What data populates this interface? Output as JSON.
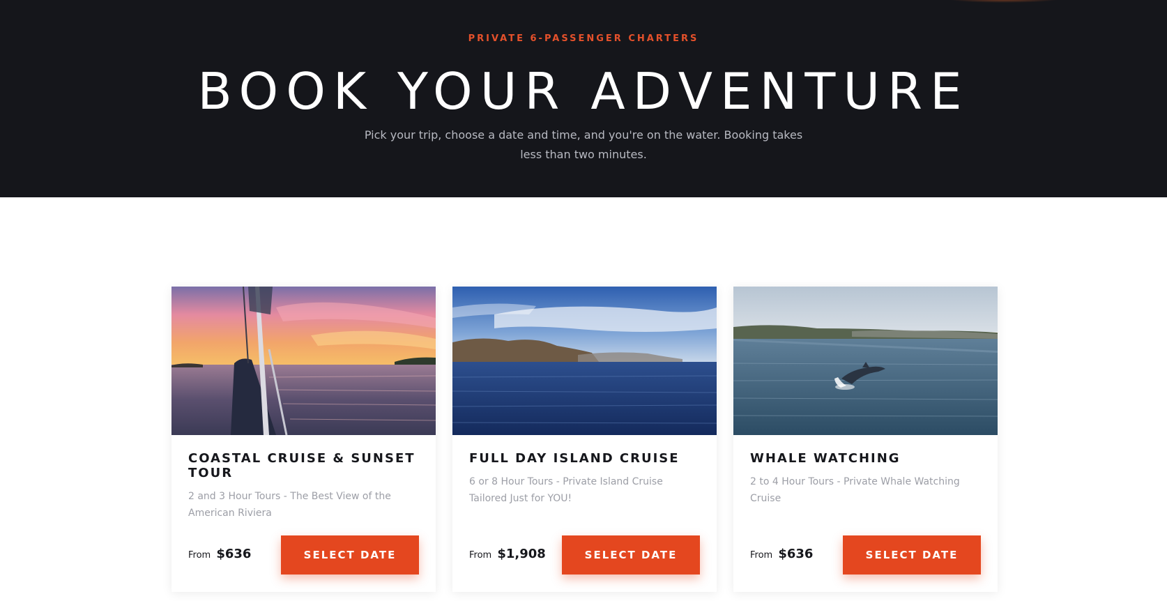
{
  "hero": {
    "eyebrow": "PRIVATE 6-PASSENGER CHARTERS",
    "title": "BOOK YOUR ADVENTURE",
    "subtitle": "Pick your trip, choose a date and time, and you're on the water. Booking takes less than two minutes."
  },
  "colors": {
    "hero_bg": "#15161b",
    "accent": "#e4471f",
    "muted_text": "#9c9ea6"
  },
  "cards": [
    {
      "title": "COASTAL CRUISE & SUNSET TOUR",
      "description": "2 and 3 Hour Tours - The Best View of the American Riviera",
      "price_prefix": "From",
      "price": "$636",
      "button": "SELECT DATE",
      "image": "sunset-sailboat-photo"
    },
    {
      "title": "FULL DAY ISLAND CRUISE",
      "description": "6 or 8 Hour Tours - Private Island Cruise Tailored Just for YOU!",
      "price_prefix": "From",
      "price": "$1,908",
      "button": "SELECT DATE",
      "image": "island-coastline-photo"
    },
    {
      "title": "WHALE WATCHING",
      "description": "2 to 4 Hour Tours - Private Whale Watching Cruise",
      "price_prefix": "From",
      "price": "$636",
      "button": "SELECT DATE",
      "image": "dolphin-jumping-photo"
    }
  ]
}
